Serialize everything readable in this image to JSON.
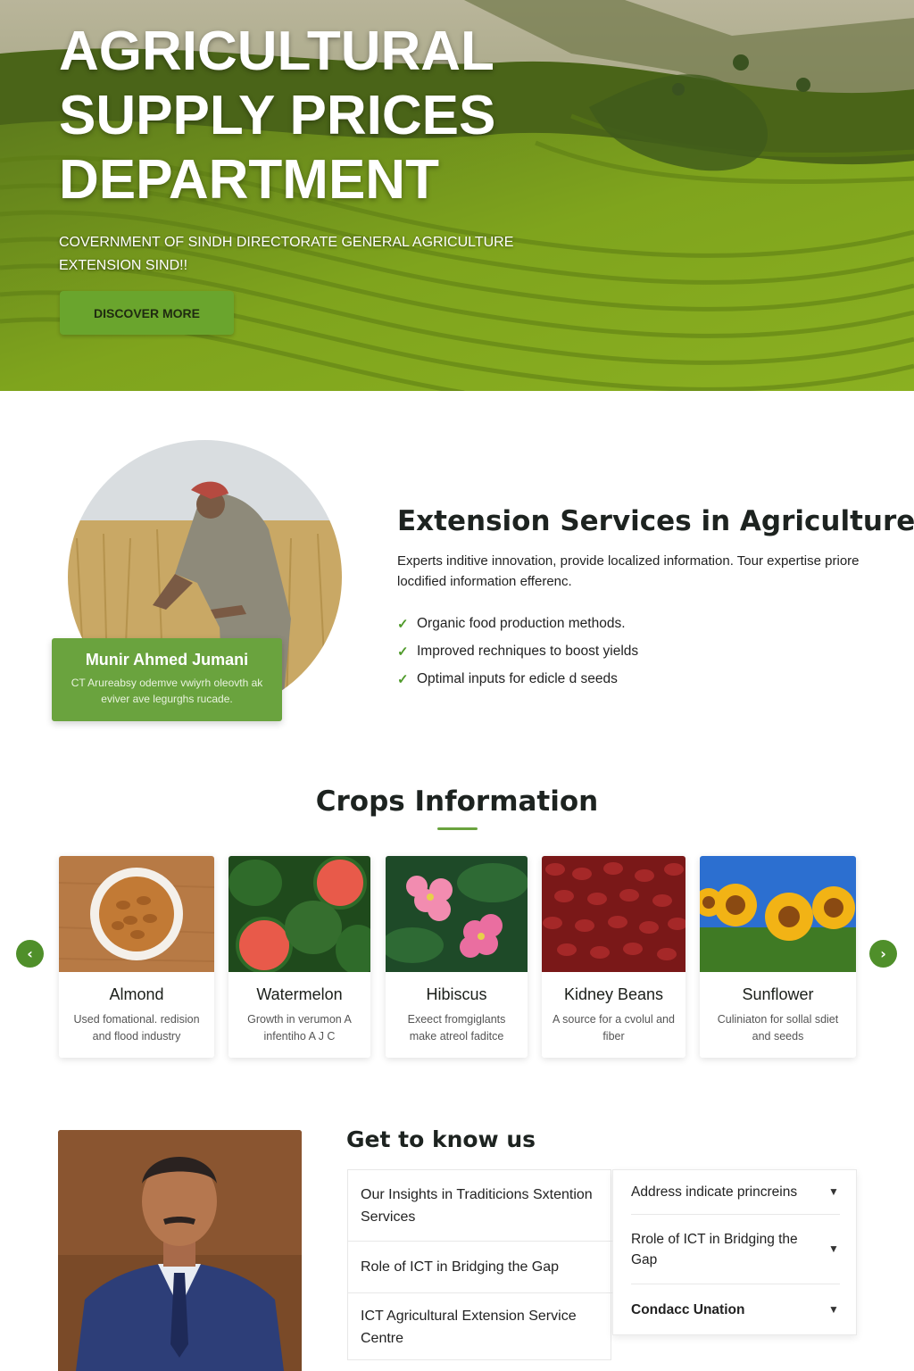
{
  "hero": {
    "title_lines": [
      "AGRICULTURAL",
      "SUPPLY PRICES",
      "DEPARTMENT"
    ],
    "subtitle": "COVERNMENT OF SINDH DIRECTORATE GENERAL AGRICULTURE EXTENSION SIND!!",
    "cta_label": "DISCOVER MORE"
  },
  "extension": {
    "title": "Extension Services in Agriculture",
    "description": "Experts inditive innovation, provide localized information. Tour expertise priore locdified information efferenc.",
    "list": [
      "Organic food production methods.",
      "Improved rechniques to boost yields",
      "Optimal inputs for edicle d seeds"
    ],
    "person": {
      "name": "Munir Ahmed Jumani",
      "description": "CT Arureabsy odemve vwiyrh oleovth ak eviver ave legurghs rucade."
    }
  },
  "crops": {
    "title": "Crops Information",
    "prev_icon": "chevron-left-icon",
    "next_icon": "chevron-right-icon",
    "items": [
      {
        "name": "Almond",
        "description": "Used fomational. redision and flood industry"
      },
      {
        "name": "Watermelon",
        "description": "Growth in verumon A infentiho A J C"
      },
      {
        "name": "Hibiscus",
        "description": "Exeect fromgiglants make atreol faditce"
      },
      {
        "name": "Kidney Beans",
        "description": "A source for a cvolul and fiber"
      },
      {
        "name": "Sunflower",
        "description": "Culiniaton for sollal sdiet and seeds"
      }
    ]
  },
  "know_us": {
    "title": "Get to know us",
    "left_items": [
      "Our Insights in Traditicions Sxtention Services",
      "Role of ICT in Bridging the Gap",
      "ICT Agricultural Extension Service Centre"
    ],
    "right_items": [
      "Address indicate princreins",
      "Rrole  of ICT in Bridging the Gap",
      "Condacc Unation"
    ]
  },
  "colors": {
    "accent_green": "#6aa33e",
    "arrow_green": "#4f8f2a",
    "check_green": "#4f9a2a"
  }
}
